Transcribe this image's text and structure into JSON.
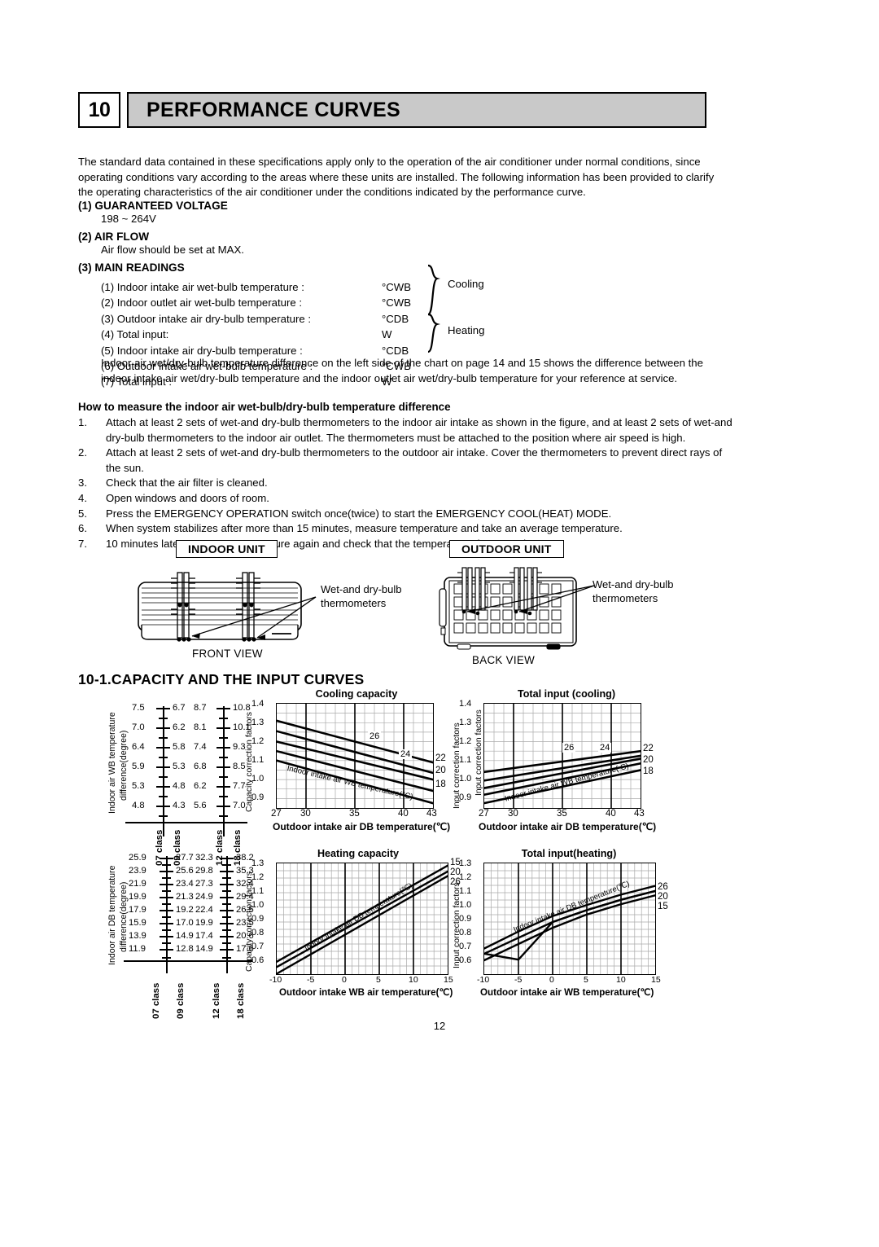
{
  "header": {
    "number": "10",
    "title": "PERFORMANCE CURVES"
  },
  "intro": "The standard data contained in these specifications apply only to the operation of the air conditioner under normal conditions, since operating conditions vary according to the areas where these units are installed. The following information has been provided to clarify the operating characteristics of the air conditioner under the conditions indicated by the performance curve.",
  "sections": {
    "s1_title": "(1) GUARANTEED VOLTAGE",
    "s1_body": "198 ~ 264V",
    "s2_title": "(2) AIR FLOW",
    "s2_body": "Air flow should be set at MAX.",
    "s3_title": "(3) MAIN READINGS"
  },
  "readings": [
    {
      "label": "(1) Indoor intake air wet-bulb temperature :",
      "unit": "°CWB"
    },
    {
      "label": "(2) Indoor outlet air wet-bulb temperature :",
      "unit": "°CWB"
    },
    {
      "label": "(3) Outdoor intake air dry-bulb temperature :",
      "unit": "°CDB"
    },
    {
      "label": "(4) Total input:",
      "unit": "W"
    },
    {
      "label": "(5) Indoor intake air dry-bulb temperature :",
      "unit": "°CDB"
    },
    {
      "label": "(6) Outdoor intake air wet-bulb temperature :",
      "unit": "°CWB"
    },
    {
      "label": "(7) Total input :",
      "unit": "W"
    }
  ],
  "brace_labels": {
    "cooling": "Cooling",
    "heating": "Heating"
  },
  "note_paragraph": "Indoor air wet/dry-bulb temperature difference on the left side of the chart on page 14 and 15 shows the difference between the indoor intake air wet/dry-bulb temperature and the indoor outlet air wet/dry-bulb temperature for your reference at service.",
  "howto": {
    "heading": "How to measure the indoor air wet-bulb/dry-bulb temperature difference",
    "items": [
      {
        "n": "1.",
        "text": "Attach at least 2 sets of wet-and dry-bulb thermometers to the indoor air intake as shown in the figure, and at least 2 sets of wet-and dry-bulb thermometers to the indoor air outlet. The thermometers must be attached to the position where air speed is high."
      },
      {
        "n": "2.",
        "text": "Attach at least 2 sets of wet-and dry-bulb thermometers to the outdoor air intake. Cover the thermometers to prevent direct rays of the sun."
      },
      {
        "n": "3.",
        "text": "Check that the air filter is cleaned."
      },
      {
        "n": "4.",
        "text": "Open windows and doors of room."
      },
      {
        "n": "5.",
        "text": "Press the EMERGENCY OPERATION switch once(twice) to start the EMERGENCY COOL(HEAT) MODE."
      },
      {
        "n": "6.",
        "text": "When system stabilizes after more than 15 minutes, measure temperature and take an average temperature."
      },
      {
        "n": "7.",
        "text": "10 minutes later, measure temperature again and check that the temperature does not change."
      }
    ]
  },
  "figures": {
    "indoor_title": "INDOOR UNIT",
    "outdoor_title": "OUTDOOR UNIT",
    "indoor_view": "FRONT VIEW",
    "outdoor_view": "BACK VIEW",
    "thermo_label": "Wet-and dry-bulb\nthermometers",
    "thermo_label_line1": "Wet-and dry-bulb",
    "thermo_label_line2": "thermometers"
  },
  "subsection_title": "10-1.CAPACITY AND THE INPUT CURVES",
  "page_number": "12",
  "ladders": {
    "cooling": {
      "axis_label_line1": "Indoor air WB temperature",
      "axis_label_line2": "difference(degree)",
      "classes": [
        "07 class",
        "09 class",
        "12 class",
        "18 class"
      ],
      "col_07": [
        "7.5",
        "7.0",
        "6.4",
        "5.9",
        "5.3",
        "4.8"
      ],
      "col_09": [
        "6.7",
        "6.2",
        "5.8",
        "5.3",
        "4.8",
        "4.3"
      ],
      "col_12": [
        "8.7",
        "8.1",
        "7.4",
        "6.8",
        "6.2",
        "5.6"
      ],
      "col_18": [
        "10.8",
        "10.1",
        "9.3",
        "8.5",
        "7.7",
        "7.0"
      ]
    },
    "heating": {
      "axis_label_line1": "Indoor air DB temperature",
      "axis_label_line2": "difference(degree)",
      "classes": [
        "07 class",
        "09 class",
        "12 class",
        "18 class"
      ],
      "col_07": [
        "25.9",
        "23.9",
        "21.9",
        "19.9",
        "17.9",
        "15.9",
        "13.9",
        "11.9"
      ],
      "col_09": [
        "27.7",
        "25.6",
        "23.4",
        "21.3",
        "19.2",
        "17.0",
        "14.9",
        "12.8"
      ],
      "col_12": [
        "32.3",
        "29.8",
        "27.3",
        "24.9",
        "22.4",
        "19.9",
        "17.4",
        "14.9"
      ],
      "col_18": [
        "38.2",
        "35.3",
        "32.4",
        "29.4",
        "26.5",
        "23.5",
        "20.6",
        "17.6"
      ]
    }
  },
  "chart_data": [
    {
      "id": "cooling_capacity",
      "type": "line",
      "title": "Cooling capacity",
      "xlabel": "Outdoor intake air DB temperature(℃)",
      "ylabel": "Capacity correction factors",
      "xlim": [
        27,
        43
      ],
      "ylim": [
        0.85,
        1.4
      ],
      "xticks": [
        27,
        30,
        35,
        40,
        43
      ],
      "yticks": [
        "0.9",
        "1.0",
        "1.1",
        "1.2",
        "1.3",
        "1.4"
      ],
      "grid": true,
      "legend_position": "inline-right",
      "inline_label": "Indoor intake air WB temperature(°C)",
      "curve_annotations": [
        "26",
        "24"
      ],
      "right_labels": [
        "22",
        "20",
        "18"
      ],
      "series": [
        {
          "name": "26",
          "x": [
            27,
            43
          ],
          "values": [
            1.31,
            1.09
          ]
        },
        {
          "name": "24",
          "x": [
            27,
            43
          ],
          "values": [
            1.255,
            1.035
          ]
        },
        {
          "name": "22",
          "x": [
            27,
            43
          ],
          "values": [
            1.2,
            1.0
          ]
        },
        {
          "name": "20",
          "x": [
            27,
            43
          ],
          "values": [
            1.15,
            0.94
          ]
        },
        {
          "name": "18",
          "x": [
            27,
            43
          ],
          "values": [
            1.1,
            0.875
          ]
        }
      ]
    },
    {
      "id": "total_input_cooling",
      "type": "line",
      "title": "Total input (cooling)",
      "xlabel": "Outdoor intake air DB temperature(℃)",
      "ylabel": "Input correction factors",
      "xlim": [
        27,
        43
      ],
      "ylim": [
        0.85,
        1.4
      ],
      "xticks": [
        27,
        30,
        35,
        40,
        43
      ],
      "yticks": [
        "0.9",
        "1.0",
        "1.1",
        "1.2",
        "1.3",
        "1.4"
      ],
      "grid": true,
      "legend_position": "inline-right",
      "inline_label": "Indoor intake air WB temperature( C)",
      "curve_annotations": [
        "26",
        "24"
      ],
      "right_labels": [
        "22",
        "20",
        "18"
      ],
      "series": [
        {
          "name": "26",
          "x": [
            27,
            43
          ],
          "values": [
            1.04,
            1.15
          ]
        },
        {
          "name": "24",
          "x": [
            27,
            43
          ],
          "values": [
            0.995,
            1.125
          ]
        },
        {
          "name": "22",
          "x": [
            27,
            43
          ],
          "values": [
            0.955,
            1.11
          ]
        },
        {
          "name": "20",
          "x": [
            27,
            43
          ],
          "values": [
            0.92,
            1.085
          ]
        },
        {
          "name": "18",
          "x": [
            27,
            43
          ],
          "values": [
            0.875,
            1.05
          ]
        }
      ]
    },
    {
      "id": "heating_capacity",
      "type": "line",
      "title": "Heating capacity",
      "xlabel": "Outdoor intake  WB  air temperature(℃)",
      "ylabel": "Capacity correction factors",
      "xlim": [
        -10,
        15
      ],
      "ylim": [
        0.55,
        1.3
      ],
      "xticks": [
        -10,
        -5,
        0,
        5,
        10,
        15
      ],
      "yticks": [
        "0.6",
        "0.7",
        "0.8",
        "0.9",
        "1.0",
        "1.1",
        "1.2",
        "1.3"
      ],
      "grid": true,
      "legend_position": "inline-right",
      "inline_label": "Indoor intake air  DB  temperature(℃)",
      "right_labels": [
        "15",
        "20",
        "26"
      ],
      "series": [
        {
          "name": "15",
          "x": [
            -10,
            15
          ],
          "values": [
            0.635,
            1.285
          ]
        },
        {
          "name": "20",
          "x": [
            -10,
            15
          ],
          "values": [
            0.6,
            1.245
          ]
        },
        {
          "name": "26",
          "x": [
            -10,
            15
          ],
          "values": [
            0.555,
            1.215
          ]
        }
      ]
    },
    {
      "id": "total_input_heating",
      "type": "line",
      "title": "Total input(heating)",
      "xlabel": "Outdoor intake air WB temperature(℃)",
      "ylabel": "Input correction factors",
      "xlim": [
        -10,
        15
      ],
      "ylim": [
        0.55,
        1.3
      ],
      "xticks": [
        -10,
        -5,
        0,
        5,
        10,
        15
      ],
      "yticks": [
        "0.6",
        "0.7",
        "0.8",
        "0.9",
        "1.0",
        "1.1",
        "1.2",
        "1.3"
      ],
      "grid": true,
      "legend_position": "inline-right",
      "inline_label": "Indoor intake air DB temperature(℃)",
      "right_labels": [
        "26",
        "20",
        "15"
      ],
      "series": [
        {
          "name": "26",
          "x": [
            -10,
            -5,
            0,
            5,
            10,
            15
          ],
          "values": [
            0.725,
            0.84,
            0.945,
            1.02,
            1.09,
            1.15
          ]
        },
        {
          "name": "20",
          "x": [
            -10,
            -5,
            0,
            5,
            10,
            15
          ],
          "values": [
            0.69,
            0.8,
            0.905,
            0.985,
            1.055,
            1.115
          ]
        },
        {
          "name": "15",
          "x": [
            -10,
            -5,
            0,
            5,
            10,
            15
          ],
          "values": [
            0.645,
            0.755,
            0.865,
            0.955,
            1.025,
            1.085
          ]
        }
      ]
    }
  ]
}
